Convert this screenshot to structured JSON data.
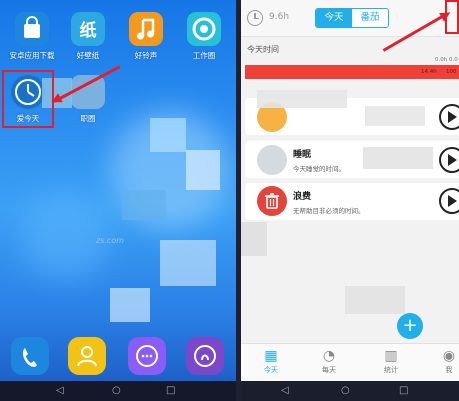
{
  "home_screen": {
    "apps": [
      {
        "label": "安卓应用下载",
        "icon": "shopping-bag-icon",
        "color": "#1e88e5"
      },
      {
        "label": "好壁纸",
        "icon": "wallpaper-app-icon",
        "color": "#2fa8e0"
      },
      {
        "label": "好铃声",
        "icon": "music-note-icon",
        "color": "#f39a1e"
      },
      {
        "label": "工作圈",
        "icon": "work-circle-icon",
        "color": "#29c1d6"
      },
      {
        "label": "爱今天",
        "icon": "clock-app-icon",
        "color": "#1a72c6"
      },
      {
        "label": "职圈",
        "icon": "career-app-icon",
        "color": "#9fc2d8"
      }
    ],
    "dock": [
      {
        "icon": "phone-icon",
        "color": "#1e88e5"
      },
      {
        "icon": "contacts-icon",
        "color": "#f2c315"
      },
      {
        "icon": "messages-icon",
        "color": "#8b5cf6"
      },
      {
        "icon": "browser-icon",
        "color": "#7a48c8"
      }
    ],
    "watermark": "zs.com",
    "nav": {
      "back": "◁",
      "home": "○",
      "recent": "□"
    }
  },
  "today_app": {
    "header": {
      "hours": "9.6h",
      "tab_today": "今天",
      "tab_tomato": "番茄"
    },
    "section_title": "今天时间",
    "progress": {
      "left_value": "0.0h",
      "right_value": "0.0h 0.0",
      "bar_value": "14.4h",
      "bar_value2": "100"
    },
    "activities": [
      {
        "title": "",
        "description": "",
        "color": "#f5a623",
        "icon": "work-icon"
      },
      {
        "title": "睡眠",
        "description": "今天睡觉的时间。",
        "color": "#7a8896",
        "icon": "sleep-icon"
      },
      {
        "title": "浪费",
        "description": "无帮助目非必须的时间。",
        "color": "#e2453c",
        "icon": "trash-icon"
      }
    ],
    "add_button": "+",
    "tabs": [
      {
        "label": "今天",
        "icon": "calendar-icon",
        "active": true
      },
      {
        "label": "每天",
        "icon": "pie-chart-icon",
        "active": false
      },
      {
        "label": "统计",
        "icon": "bar-chart-icon",
        "active": false
      },
      {
        "label": "我",
        "icon": "person-icon",
        "active": false
      }
    ],
    "nav": {
      "back": "◁",
      "home": "○",
      "recent": "□"
    }
  }
}
